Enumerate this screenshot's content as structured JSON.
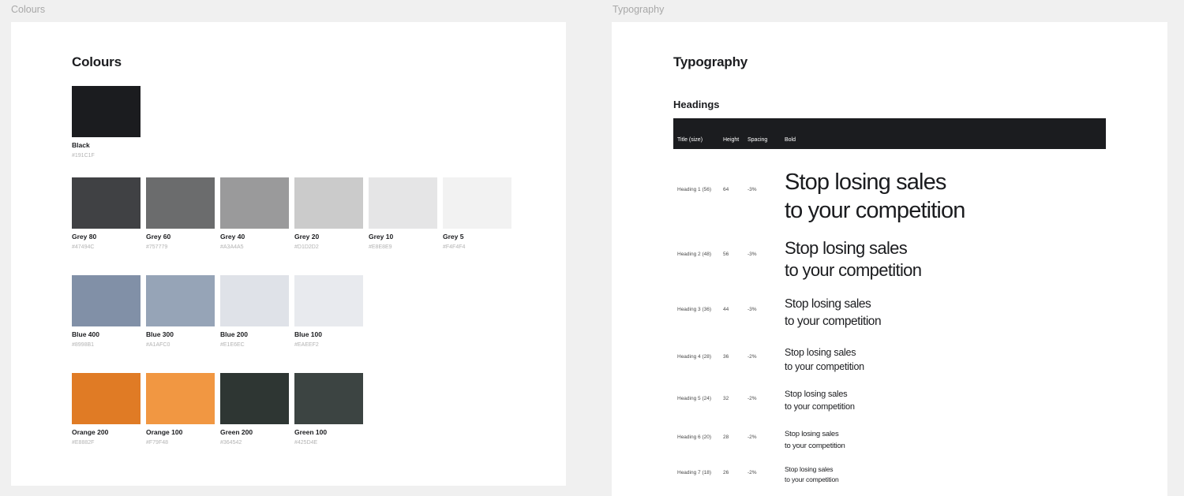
{
  "colours_frame": {
    "label": "Colours",
    "title": "Colours",
    "groups": [
      [
        {
          "name": "Black",
          "hex": "#191C1F",
          "color": "#1B1C1F"
        }
      ],
      [
        {
          "name": "Grey 80",
          "hex": "#47494C",
          "color": "#404144"
        },
        {
          "name": "Grey 60",
          "hex": "#757779",
          "color": "#6B6C6D"
        },
        {
          "name": "Grey 40",
          "hex": "#A3A4A5",
          "color": "#9A9A9B"
        },
        {
          "name": "Grey 20",
          "hex": "#D1D2D2",
          "color": "#CBCBCB"
        },
        {
          "name": "Grey 10",
          "hex": "#E8E8E9",
          "color": "#E5E5E6"
        },
        {
          "name": "Grey 5",
          "hex": "#F4F4F4",
          "color": "#F2F2F2"
        }
      ],
      [
        {
          "name": "Blue 400",
          "hex": "#8998B1",
          "color": "#8190A7"
        },
        {
          "name": "Blue 300",
          "hex": "#A1AFC0",
          "color": "#96A4B7"
        },
        {
          "name": "Blue 200",
          "hex": "#E1E6EC",
          "color": "#DFE2E8"
        },
        {
          "name": "Blue 100",
          "hex": "#EAEEF2",
          "color": "#E8EAEE"
        }
      ],
      [
        {
          "name": "Orange 200",
          "hex": "#E8882F",
          "color": "#E07B25"
        },
        {
          "name": "Orange 100",
          "hex": "#F79F48",
          "color": "#F19742"
        },
        {
          "name": "Green 200",
          "hex": "#364542",
          "color": "#2E3633"
        },
        {
          "name": "Green 100",
          "hex": "#425D4E",
          "color": "#3C4442"
        }
      ]
    ]
  },
  "typography_frame": {
    "label": "Typography",
    "title": "Typography",
    "headings_title": "Headings",
    "table_header": {
      "title": "Title (size)",
      "height": "Height",
      "spacing": "Spacing",
      "bold": "Bold"
    },
    "rows": [
      {
        "title": "Heading 1 (56)",
        "height": "64",
        "spacing": "-3%",
        "line1": "Stop losing sales",
        "line2": "to your competition"
      },
      {
        "title": "Heading 2 (48)",
        "height": "56",
        "spacing": "-3%",
        "line1": "Stop losing sales",
        "line2": "to your competition"
      },
      {
        "title": "Heading 3 (36)",
        "height": "44",
        "spacing": "-3%",
        "line1": "Stop losing sales",
        "line2": "to your competition"
      },
      {
        "title": "Heading 4 (28)",
        "height": "36",
        "spacing": "-2%",
        "line1": "Stop losing sales",
        "line2": "to your competition"
      },
      {
        "title": "Heading 5 (24)",
        "height": "32",
        "spacing": "-2%",
        "line1": "Stop losing sales",
        "line2": "to your competition"
      },
      {
        "title": "Heading 6 (20)",
        "height": "28",
        "spacing": "-2%",
        "line1": "Stop losing sales",
        "line2": "to your competition"
      },
      {
        "title": "Heading 7 (18)",
        "height": "26",
        "spacing": "-2%",
        "line1": "Stop losing sales",
        "line2": "to your competition"
      }
    ]
  }
}
